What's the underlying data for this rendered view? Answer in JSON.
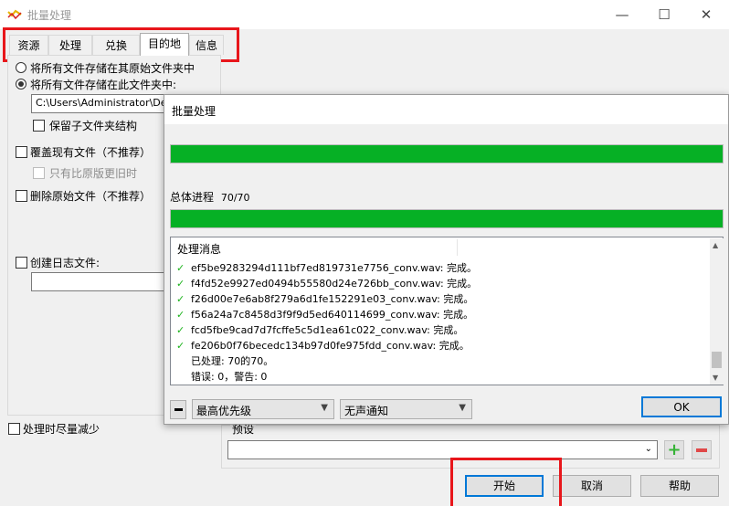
{
  "window": {
    "title": "批量处理",
    "min_icon": "minimize-icon",
    "max_icon": "maximize-icon",
    "close_icon": "close-icon"
  },
  "tabs": [
    {
      "label": "资源"
    },
    {
      "label": "处理"
    },
    {
      "label": "兑换"
    },
    {
      "label": "目的地",
      "active": true
    },
    {
      "label": "信息"
    }
  ],
  "destination": {
    "radio_original": "将所有文件存储在其原始文件夹中",
    "radio_this_folder": "将所有文件存储在此文件夹中:",
    "folder_path": "C:\\Users\\Administrator\\Desktop",
    "keep_subfolders": "保留子文件夹结构",
    "overwrite": "覆盖现有文件（不推荐）",
    "only_newer": "只有比原版更旧时",
    "delete_original": "删除原始文件（不推荐）",
    "create_log": "创建日志文件:",
    "log_path": ""
  },
  "bottom": {
    "minimize_processing": "处理时尽量减少",
    "preset_label": "预设",
    "preset_value": "",
    "add_icon": "plus-icon",
    "remove_icon": "minus-icon",
    "start": "开始",
    "cancel": "取消",
    "help": "帮助"
  },
  "progress_dialog": {
    "title": "批量处理",
    "file_progress": 1.0,
    "overall_label": "总体进程",
    "overall_count": "70/70",
    "overall_progress": 1.0,
    "messages_header": "处理消息",
    "messages": [
      "ef5be9283294d111bf7ed819731e7756_conv.wav: 完成。",
      "f4fd52e9927ed0494b55580d24e726bb_conv.wav: 完成。",
      "f26d00e7e6ab8f279a6d1fe152291e03_conv.wav: 完成。",
      "f56a24a7c8458d3f9f9d5ed640114699_conv.wav: 完成。",
      "fcd5fbe9cad7d7fcffe5c5d1ea61c022_conv.wav: 完成。",
      "fe206b0f76becedc134b97d0fe975fdd_conv.wav: 完成。"
    ],
    "summary_processed": "已处理: 70的70。",
    "summary_errors": "错误: 0，警告: 0",
    "priority": "最高优先级",
    "notify": "无声通知",
    "ok": "OK",
    "success_color": "#06b025"
  }
}
